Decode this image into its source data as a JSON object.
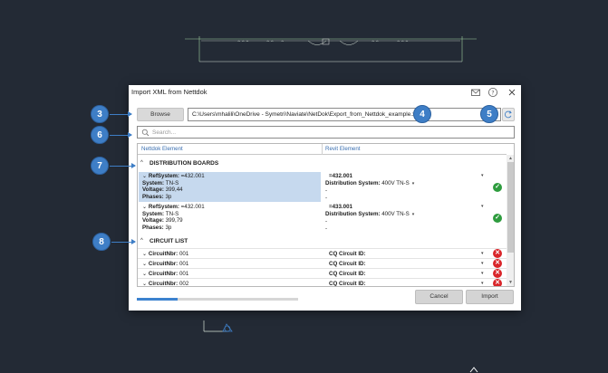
{
  "dialog": {
    "title": "Import XML from Nettdok",
    "browse_label": "Browse",
    "file_path": "C:\\Users\\mhalili\\OneDrive - Symetri\\Naviate\\NetDok\\Export_from_Nettdok_example.xml",
    "search_placeholder": "Search...",
    "cancel_label": "Cancel",
    "import_label": "Import",
    "progress": 0.25
  },
  "table": {
    "headers": [
      "Nettdok Element",
      "Revit Element"
    ],
    "distribution_boards": {
      "label": "DISTRIBUTION BOARDS",
      "rows": [
        {
          "left_title": "RefSystem: ",
          "left_title_value": "=432.001",
          "system_key": "System: ",
          "system_value": "TN-S",
          "voltage_key": "Voltage: ",
          "voltage_value": "399,44",
          "phases_key": "Phases: ",
          "phases_value": "3p",
          "right_title": "=432.001",
          "dist_key": "Distribution System: ",
          "dist_value": "400V TN-S",
          "dash1": "-",
          "dash2": "-",
          "status": "ok"
        },
        {
          "left_title": "RefSystem: ",
          "left_title_value": "=432.001",
          "system_key": "System: ",
          "system_value": "TN-S",
          "voltage_key": "Voltage: ",
          "voltage_value": "399,79",
          "phases_key": "Phases: ",
          "phases_value": "3p",
          "right_title": "=433.001",
          "dist_key": "Distribution System: ",
          "dist_value": "400V TN-S",
          "dash1": "-",
          "dash2": "-",
          "status": "ok"
        }
      ]
    },
    "circuit_list": {
      "label": "CIRCUIT LIST",
      "rows": [
        {
          "key": "CircuitNbr: ",
          "value": "001",
          "right": "CQ Circuit ID:"
        },
        {
          "key": "CircuitNbr: ",
          "value": "001",
          "right": "CQ Circuit ID:"
        },
        {
          "key": "CircuitNbr: ",
          "value": "001",
          "right": "CQ Circuit ID:"
        },
        {
          "key": "CircuitNbr: ",
          "value": "002",
          "right": "CQ Circuit ID:"
        }
      ]
    }
  },
  "callouts": [
    "3",
    "4",
    "5",
    "6",
    "7",
    "8"
  ],
  "colors": {
    "accent": "#3e7ec6",
    "ok": "#2e9c3e",
    "error": "#d9262b",
    "selection": "#c6d9ee",
    "background": "#232a35"
  },
  "icons": [
    "mail-icon",
    "help-icon",
    "close-icon",
    "refresh-icon",
    "search-icon",
    "check-icon",
    "x-icon",
    "chevron-down-icon",
    "chevron-up-icon"
  ]
}
